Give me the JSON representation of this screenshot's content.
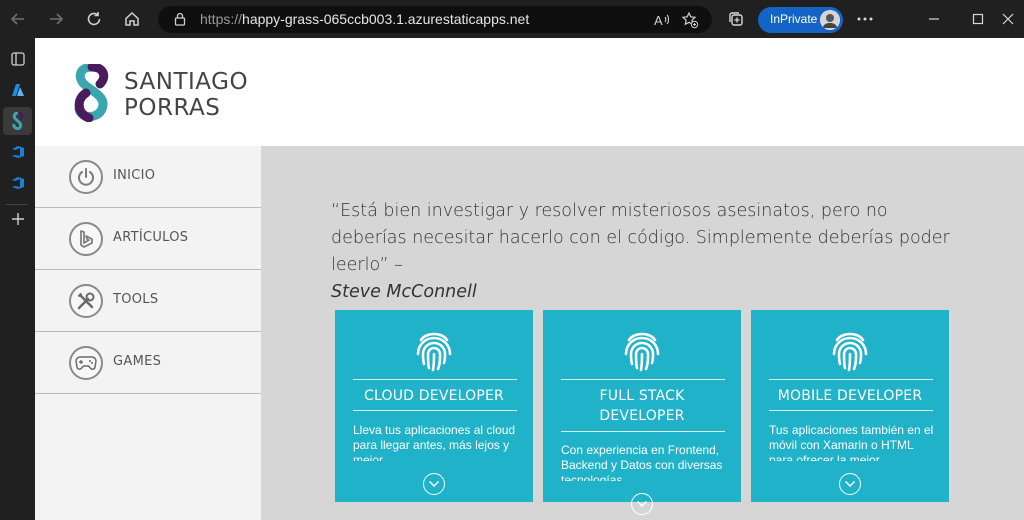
{
  "browser": {
    "url_protocol": "https://",
    "url_host": "happy-grass-065ccb003.1.azurestaticapps.net",
    "inprivate_label": "InPrivate"
  },
  "site": {
    "logo_line1": "SANTIAGO",
    "logo_line2": "PORRAS",
    "brand_colors": {
      "purple": "#4a1b5a",
      "teal": "#3aa6b0",
      "card": "#20b2c8"
    }
  },
  "menu": {
    "items": [
      {
        "label": "INICIO",
        "icon": "power-icon"
      },
      {
        "label": "ARTÍCULOS",
        "icon": "bing-icon"
      },
      {
        "label": "TOOLS",
        "icon": "tools-icon"
      },
      {
        "label": "GAMES",
        "icon": "gamepad-icon"
      }
    ]
  },
  "quote": {
    "text": "“Está bien investigar y resolver misteriosos asesinatos, pero no deberías necesitar hacerlo con el código. Simplemente deberías poder leerlo” –",
    "author": "Steve McConnell"
  },
  "cards": [
    {
      "title": "CLOUD DEVELOPER",
      "desc": "Lleva tus aplicaciones al cloud para llegar antes, más lejos y mejor"
    },
    {
      "title": "FULL STACK DEVELOPER",
      "desc": "Con experiencia en Frontend, Backend y Datos con diversas tecnologías"
    },
    {
      "title": "MOBILE DEVELOPER",
      "desc": "Tus aplicaciones también en el móvil con Xamarin o HTML para ofrecer la mejor"
    }
  ]
}
